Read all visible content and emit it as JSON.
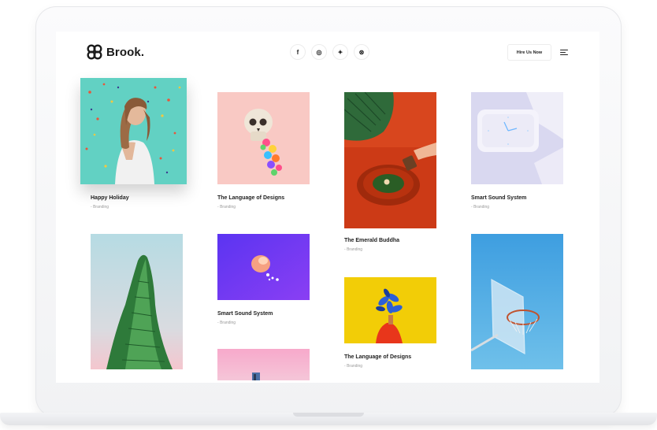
{
  "brand": {
    "name": "Brook."
  },
  "socials": [
    {
      "icon": "facebook-icon",
      "glyph": "f"
    },
    {
      "icon": "instagram-icon",
      "glyph": "◎"
    },
    {
      "icon": "twitter-icon",
      "glyph": "✦"
    },
    {
      "icon": "dribbble-icon",
      "glyph": "⊛"
    }
  ],
  "header": {
    "hire_label": "Hire Us Now",
    "menu_icon": "hamburger-icon"
  },
  "portfolio": [
    {
      "title": "Happy Holiday",
      "category": "Branding"
    },
    {
      "title": "The Language of Designs",
      "category": "Branding"
    },
    {
      "title": "The Emerald Buddha",
      "category": "Branding"
    },
    {
      "title": "Smart Sound System",
      "category": "Branding"
    },
    {
      "title": "Smart Sound System",
      "category": "Branding"
    },
    {
      "title": "The Language of Designs",
      "category": "Branding"
    }
  ],
  "colors": {
    "teal": "#62d1c3",
    "pink": "#f9c9c4",
    "orange_red": "#d5441d",
    "lavender": "#d9d8f0",
    "purple": "#7338f5",
    "yellow": "#f2cd07",
    "sky_blue": "#58b1e2"
  }
}
